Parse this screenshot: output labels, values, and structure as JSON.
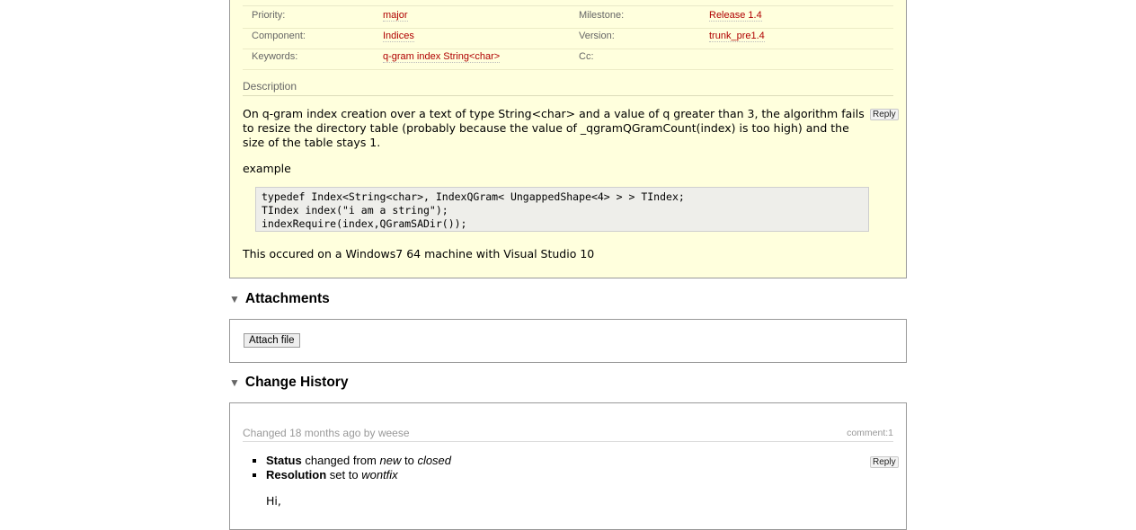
{
  "properties": {
    "rows": [
      {
        "h1": "Priority:",
        "v1": "major",
        "h2": "Milestone:",
        "v2": "Release 1.4"
      },
      {
        "h1": "Component:",
        "v1": "Indices",
        "h2": "Version:",
        "v2": "trunk_pre1.4"
      },
      {
        "h1": "Keywords:",
        "v1": "q-gram index String<char>",
        "h2": "Cc:",
        "v2": ""
      }
    ]
  },
  "description": {
    "heading": "Description",
    "reply_label": "Reply",
    "text": "On q-gram index creation over a text of type String<char> and a value of q greater than 3, the algorithm fails to resize the directory table (probably because the value of _qgramQGramCount(index) is too high) and the size of the table stays 1.",
    "example_label": "example",
    "code": "typedef Index<String<char>, IndexQGram< UngappedShape<4> > > TIndex;\nTIndex index(\"i am a string\");\nindexRequire(index,QGramSADir());",
    "footer": "This occured on a Windows7 64 machine with Visual Studio 10"
  },
  "attachments": {
    "heading": "Attachments",
    "attach_button": "Attach file"
  },
  "history": {
    "heading": "Change History",
    "changed_prefix": "Changed",
    "time_ago": "18 months ago",
    "by": "by",
    "author": "weese",
    "comment_ref": "comment:1",
    "reply_label": "Reply",
    "changes": [
      {
        "field": "Status",
        "verb": "changed from",
        "old": "new",
        "to": "to",
        "new": "closed"
      },
      {
        "field": "Resolution",
        "verb": "set to",
        "new": "wontfix"
      }
    ],
    "comment_start": "Hi,"
  },
  "icons": {
    "fold": "triangle-down-icon"
  },
  "colors": {
    "ticket_bg": "#ffffdd",
    "link": "#b00000"
  }
}
